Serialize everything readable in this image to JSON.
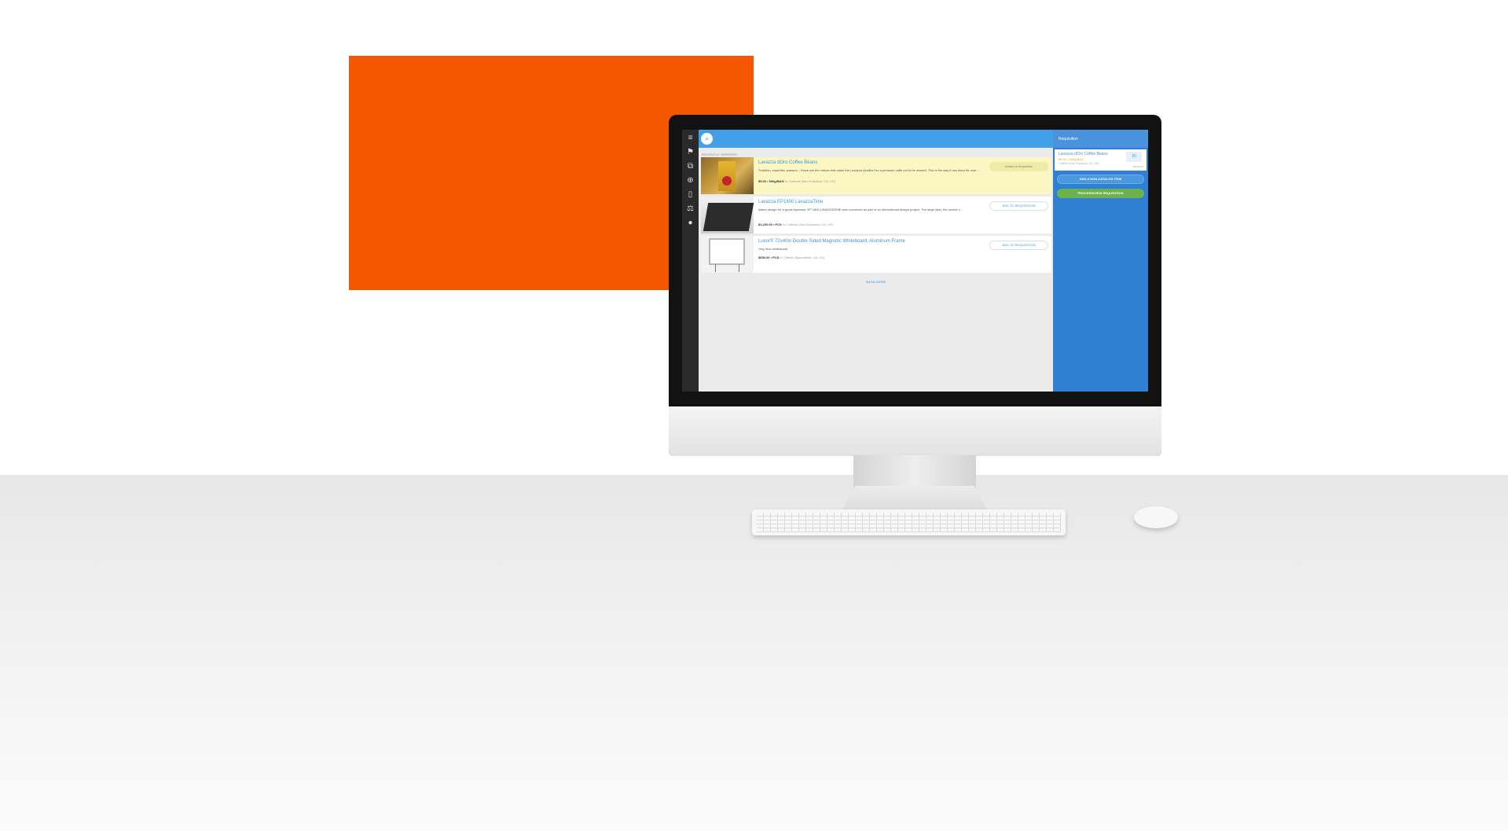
{
  "colors": {
    "accent_orange": "#f55600",
    "topbar_blue": "#42a0e8",
    "requisition_panel_blue": "#2f80d2",
    "process_button_green": "#6cb24a",
    "highlight_yellow": "#faf7c2"
  },
  "sidebar": {
    "icons": [
      "menu-icon",
      "flag-icon",
      "tags-icon",
      "globe-icon",
      "document-icon",
      "balance-icon",
      "user-icon"
    ]
  },
  "main": {
    "section_label": "RECENTLY ORDERED",
    "items": [
      {
        "title": "Lavazza dOro Coffee Beans",
        "description": "Tradition, expertise, passion – these are the virtues that make the Lavazza Qualita Oro a premium caffe not to be missed. This is the way it has been for over ...",
        "price": "$5.00 • 500g/BAG",
        "location_prefix": "in:",
        "location": "Coffeed (San Francisco, CA, US)",
        "action_label": "Added to requisition"
      },
      {
        "title": "Lavazza EP1800 LavazzaTime",
        "description": "Italian design for a great espresso. EP 1800 LAVAZZATIME was conceived as part of an international design project. The large tank, the double s...",
        "price": "$1,200.00 • PCS",
        "location_prefix": "in:",
        "location": "Coffeed (San Francisco, CA, US)",
        "action_label": "ADD TO REQUISITION"
      },
      {
        "title": "Luxor® 72x40in Double Sided Magnetic Whiteboard, Aluminum Frame",
        "description": "Very nice whiteboard",
        "price": "$650.00 • PCS",
        "location_prefix": "in:",
        "location": "Offices (Bakersfield, CA, US)",
        "action_label": "ADD TO REQUISITION"
      }
    ],
    "show_more": "SHOW MORE"
  },
  "requisition": {
    "title": "Requisition",
    "item": {
      "name": "Lavazza dOro Coffee Beans",
      "price": "$5.00 • 500g/BAG",
      "location": "Coffeed (San Francisco, CA, US)",
      "quantity": "20",
      "remove_label": "REMOVE"
    },
    "add_non_catalog_label": "ADD A NON-CATALOG ITEM",
    "process_label": "PROCESS/VIEW REQUISITION"
  }
}
